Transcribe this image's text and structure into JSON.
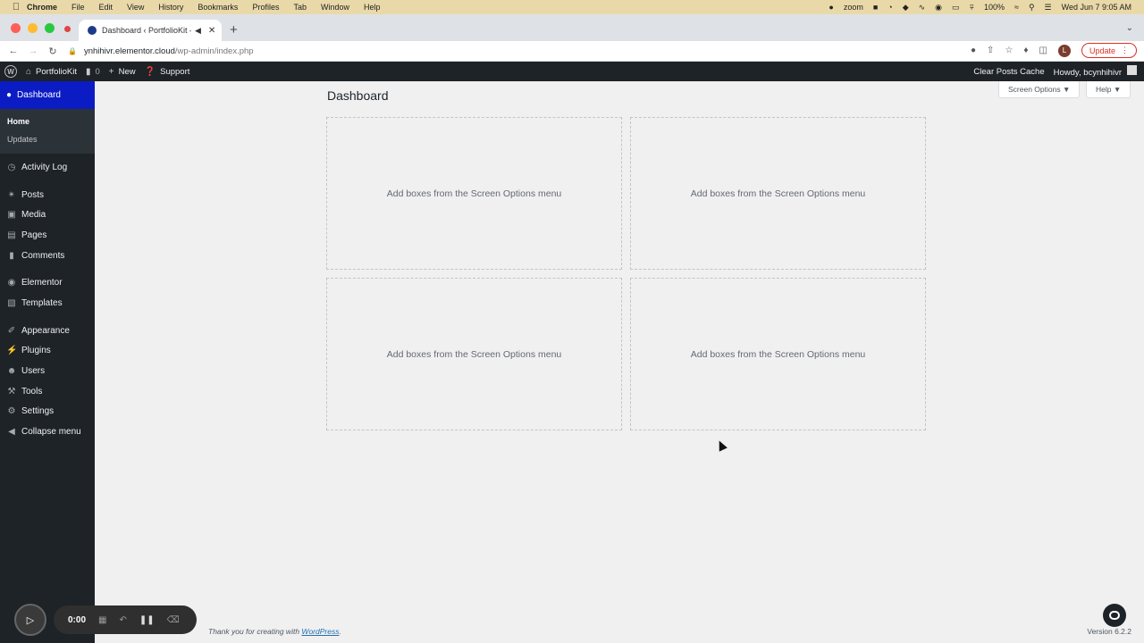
{
  "macos_menubar": {
    "apple_icon": "apple-logo-icon",
    "menus": [
      "Chrome",
      "File",
      "Edit",
      "View",
      "History",
      "Bookmarks",
      "Profiles",
      "Tab",
      "Window",
      "Help"
    ],
    "zoom_label": "zoom",
    "battery": "100%",
    "datetime": "Wed Jun 7  9:05 AM"
  },
  "browser": {
    "tab_title": "Dashboard ‹ PortfolioKit —",
    "new_tab_icon": "plus-icon",
    "url_host": "ynhihivr.elementor.cloud",
    "url_path": "/wp-admin/index.php",
    "update_label": "Update",
    "profile_initial": "L"
  },
  "adminbar": {
    "site_name": "PortfolioKit",
    "comments_count": "0",
    "new_label": "New",
    "support_label": "Support",
    "clear_cache_label": "Clear Posts Cache",
    "howdy_label": "Howdy, bcynhihivr"
  },
  "sidebar": {
    "current": "Dashboard",
    "submenu": [
      "Home",
      "Updates"
    ],
    "items": [
      {
        "label": "Activity Log",
        "icon": "clock-icon"
      },
      {
        "label": "Posts",
        "icon": "pin-icon"
      },
      {
        "label": "Media",
        "icon": "media-icon"
      },
      {
        "label": "Pages",
        "icon": "page-icon"
      },
      {
        "label": "Comments",
        "icon": "comment-icon"
      },
      {
        "label": "Elementor",
        "icon": "elementor-icon"
      },
      {
        "label": "Templates",
        "icon": "folder-icon"
      },
      {
        "label": "Appearance",
        "icon": "brush-icon"
      },
      {
        "label": "Plugins",
        "icon": "plug-icon"
      },
      {
        "label": "Users",
        "icon": "user-icon"
      },
      {
        "label": "Tools",
        "icon": "wrench-icon"
      },
      {
        "label": "Settings",
        "icon": "settings-icon"
      },
      {
        "label": "Collapse menu",
        "icon": "collapse-icon"
      }
    ]
  },
  "main": {
    "title": "Dashboard",
    "screen_options_label": "Screen Options ▼",
    "help_label": "Help ▼",
    "box_placeholder": "Add boxes from the Screen Options menu"
  },
  "footer": {
    "thanks_prefix": "Thank you for creating with ",
    "wordpress_link": "WordPress",
    "thanks_suffix": ".",
    "version": "Version 6.2.2"
  },
  "recorder": {
    "time": "0:00"
  },
  "colors": {
    "admin_dark": "#1d2327",
    "menu_current": "#0b1cc4",
    "macbar": "#e9d9a8",
    "update_red": "#d93025"
  }
}
